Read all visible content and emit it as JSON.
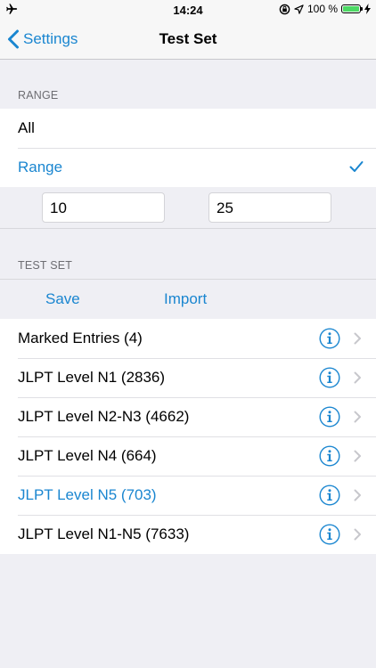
{
  "status_bar": {
    "time": "14:24",
    "battery_text": "100 %",
    "battery_level": 1.0,
    "icons": [
      "airplane-icon",
      "rotation-lock-icon",
      "location-arrow-icon",
      "battery-icon",
      "charging-bolt-icon"
    ]
  },
  "navbar": {
    "back_label": "Settings",
    "title": "Test Set"
  },
  "range_section": {
    "header": "RANGE",
    "options": [
      {
        "label": "All",
        "selected": false
      },
      {
        "label": "Range",
        "selected": true
      }
    ],
    "from_value": "10",
    "to_value": "25"
  },
  "test_set_section": {
    "header": "TEST SET",
    "save_label": "Save",
    "import_label": "Import",
    "items": [
      {
        "label": "Marked Entries (4)",
        "highlighted": false
      },
      {
        "label": "JLPT Level N1 (2836)",
        "highlighted": false
      },
      {
        "label": "JLPT Level N2-N3 (4662)",
        "highlighted": false
      },
      {
        "label": "JLPT Level N4 (664)",
        "highlighted": false
      },
      {
        "label": "JLPT Level N5 (703)",
        "highlighted": true
      },
      {
        "label": "JLPT Level N1-N5 (7633)",
        "highlighted": false
      }
    ]
  },
  "colors": {
    "accent": "#1a86d0",
    "background": "#efeff4",
    "battery": "#4cd964"
  }
}
